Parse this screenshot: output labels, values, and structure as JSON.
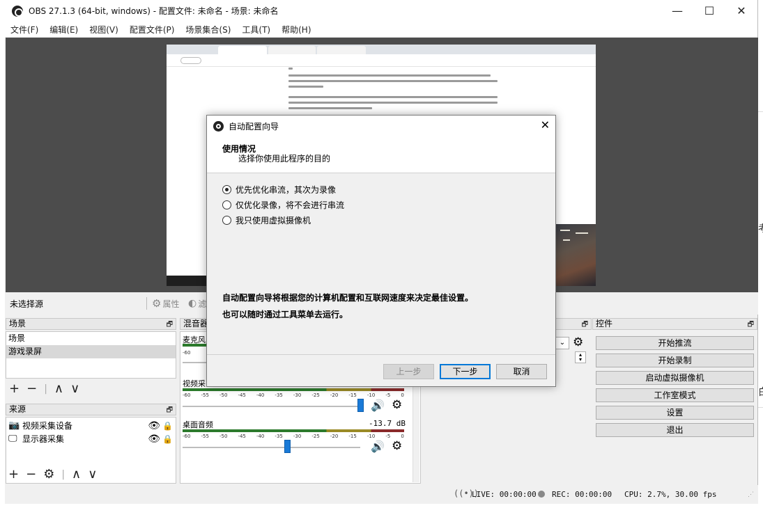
{
  "window": {
    "title": "OBS 27.1.3 (64-bit, windows) - 配置文件: 未命名 - 场景: 未命名",
    "minimize": "—",
    "maximize": "☐",
    "close": "✕"
  },
  "menu": [
    "文件(F)",
    "编辑(E)",
    "视图(V)",
    "配置文件(P)",
    "场景集合(S)",
    "工具(T)",
    "帮助(H)"
  ],
  "source_toolbar": {
    "no_source": "未选择源",
    "properties": "属性",
    "filters": "滤"
  },
  "scenes": {
    "header": "场景",
    "items": [
      "场景",
      "游戏录屏"
    ]
  },
  "sources": {
    "header": "来源",
    "items": [
      "视频采集设备",
      "显示器采集"
    ]
  },
  "mixer": {
    "header": "混音器",
    "channels": [
      {
        "name": "麦克风"
      },
      {
        "name": "视频采"
      },
      {
        "name": "桌面音频",
        "level": "-13.7 dB"
      }
    ],
    "scale": [
      "-60",
      "-55",
      "-50",
      "-45",
      "-40",
      "-35",
      "-30",
      "-25",
      "-20",
      "-15",
      "-10",
      "-5",
      "0"
    ]
  },
  "controls": {
    "header": "控件",
    "buttons": [
      "开始推流",
      "开始录制",
      "启动虚拟摄像机",
      "工作室模式",
      "设置",
      "退出"
    ]
  },
  "status": {
    "live": "LIVE: 00:00:00",
    "rec": "REC: 00:00:00",
    "cpu": "CPU: 2.7%, 30.00 fps"
  },
  "dialog": {
    "title": "自动配置向导",
    "heading": "使用情况",
    "subheading": "选择你使用此程序的目的",
    "options": [
      "优先优化串流，其次为录像",
      "仅优化录像，将不会进行串流",
      "我只使用虚拟摄像机"
    ],
    "selected_index": 0,
    "info1": "自动配置向导将根据您的计算机配置和互联网速度来决定最佳设置。",
    "info2": "也可以随时通过工具菜单去运行。",
    "back": "上一步",
    "next": "下一步",
    "cancel": "取消"
  }
}
